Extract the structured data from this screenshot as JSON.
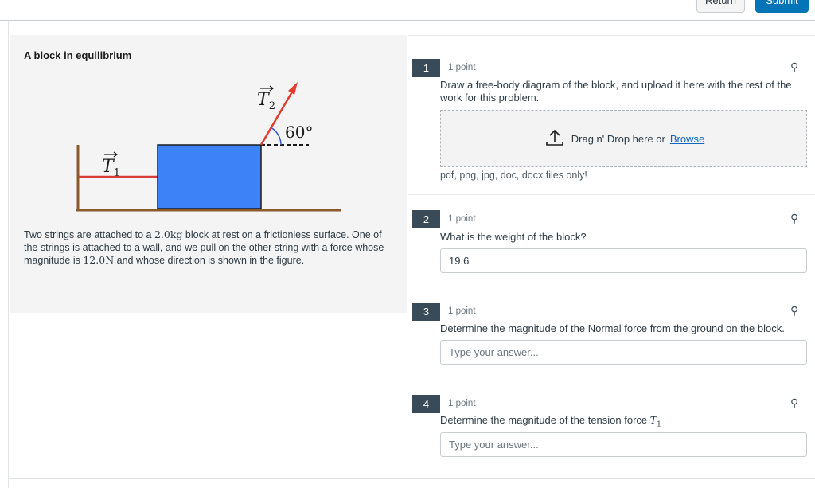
{
  "header": {
    "return_label": "Return",
    "submit_label": "Submit"
  },
  "stimulus": {
    "title": "A block in equilibrium",
    "figure": {
      "t1_label": "T",
      "t1_sub": "1",
      "t2_label": "T",
      "t2_sub": "2",
      "angle_label": "60°",
      "colors": {
        "block": "#3e82f7",
        "string1": "#d93a3a",
        "string2": "#e53a2e",
        "ground": "#8b5a2b",
        "angle_arc": "#2f57d8"
      }
    },
    "text_a": "Two strings are attached to a ",
    "mass": "2.0kg",
    "text_b": " block at rest on a frictionless surface. One of the strings is attached to a wall, and we pull on the other string with a force whose magnitude is ",
    "force": "12.0N",
    "text_c": " and whose direction is shown in the figure."
  },
  "questions": [
    {
      "number": "1",
      "points": "1 point",
      "prompt": "Draw a free-body diagram of the block, and upload it here with the rest of the work for this problem.",
      "upload": {
        "drag_text": "Drag n' Drop here or",
        "browse_label": "Browse",
        "filetypes": "pdf, png, jpg, doc, docx files only!"
      }
    },
    {
      "number": "2",
      "points": "1 point",
      "prompt": "What is the weight of the block?",
      "value": "19.6",
      "placeholder": "Type your answer..."
    },
    {
      "number": "3",
      "points": "1 point",
      "prompt": "Determine the magnitude of the Normal force from the ground on the block.",
      "value": "",
      "placeholder": "Type your answer..."
    },
    {
      "number": "4",
      "points": "1 point",
      "prompt": "Determine the magnitude of the tension force ",
      "prompt_math": "T",
      "prompt_math_sub": "1",
      "value": "",
      "placeholder": "Type your answer..."
    }
  ],
  "icons": {
    "pin": "pin-icon",
    "upload": "upload-icon"
  }
}
